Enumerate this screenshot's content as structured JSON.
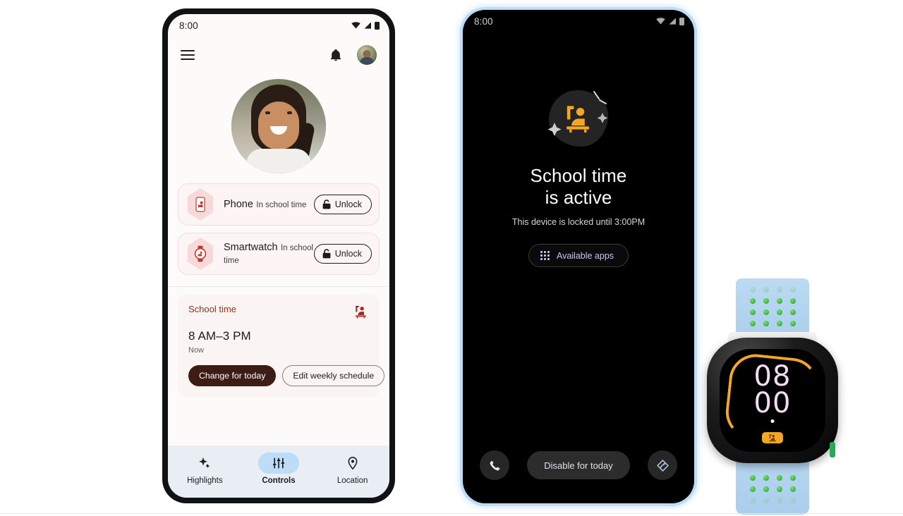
{
  "scene": {
    "background": "#ffffff"
  },
  "phone_light": {
    "status_bar": {
      "clock": "8:00",
      "icons": [
        "wifi-icon",
        "signal-icon",
        "battery-icon"
      ]
    },
    "app_bar": {
      "menu_icon": "hamburger-menu-icon",
      "notifications_icon": "bell-icon",
      "avatar": "parent-avatar"
    },
    "child_photo_alt": "child-profile-photo",
    "devices": [
      {
        "icon": "phone-device-icon",
        "title": "Phone",
        "subtitle": "In school time",
        "action": "Unlock",
        "action_icon": "lock-icon"
      },
      {
        "icon": "smartwatch-device-icon",
        "title": "Smartwatch",
        "subtitle": "In school time",
        "action": "Unlock",
        "action_icon": "lock-icon"
      }
    ],
    "school_card": {
      "label": "School time",
      "icon": "student-raising-hand-icon",
      "time_range": "8 AM–3 PM",
      "status": "Now",
      "primary_action": "Change for today",
      "secondary_action": "Edit weekly schedule"
    },
    "bottom_nav": {
      "items": [
        {
          "label": "Highlights",
          "icon": "sparkle-icon",
          "active": false
        },
        {
          "label": "Controls",
          "icon": "sliders-icon",
          "active": true
        },
        {
          "label": "Location",
          "icon": "map-pin-icon",
          "active": false
        }
      ],
      "active_index": 1
    },
    "colors": {
      "screen_bg": "#fcfbf9",
      "card_bg": "#fdf5f5",
      "school_card_bg": "#faf4f3",
      "accent_red": "#9c2c22",
      "primary_button_bg": "#3c1c14",
      "nav_bg": "#e9eef4",
      "nav_pill_active": "#bcdcf8"
    }
  },
  "phone_dark": {
    "status_bar": {
      "clock": "8:00",
      "icons": [
        "wifi-icon",
        "signal-icon",
        "battery-icon"
      ]
    },
    "hero_icon": "student-raising-hand-icon",
    "title_line1": "School time",
    "title_line2": "is active",
    "subtitle": "This device is locked until 3:00PM",
    "available_apps_button": {
      "label": "Available apps",
      "icon": "app-grid-icon"
    },
    "bottom_actions": {
      "left_icon": "phone-call-icon",
      "center_label": "Disable for today",
      "right_icon": "emergency-icon"
    },
    "colors": {
      "bezel": "#bcdcf8",
      "screen_bg": "#000000",
      "accent_orange": "#f5a623",
      "apps_text": "#c9c7f3",
      "disable_bg": "#2c2c2c"
    }
  },
  "watch": {
    "time_hours": "08",
    "time_minutes": "00",
    "chip_icon": "student-raising-hand-icon",
    "band_color": "#bcdaf2",
    "dot_color": "#2aa85a",
    "arc_color": "#f5a623",
    "digit_color": "#f3dcf3"
  }
}
